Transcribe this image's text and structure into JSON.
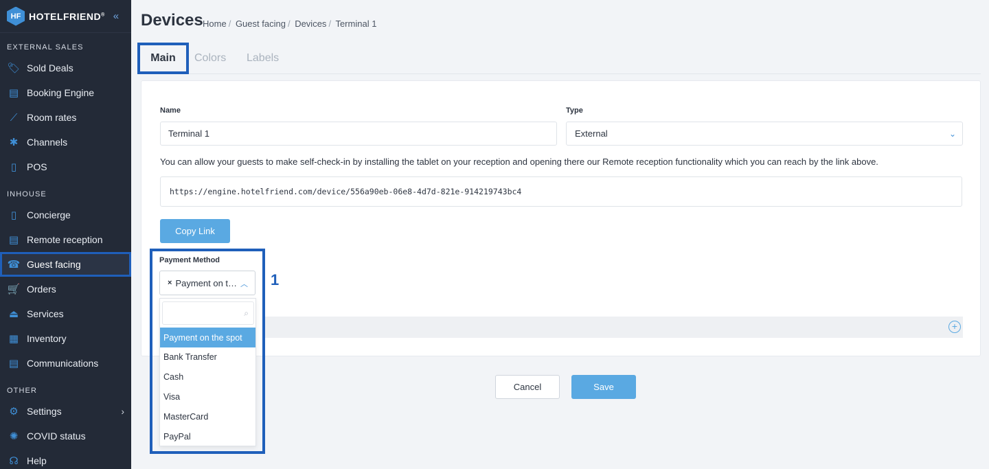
{
  "brand": {
    "logo_mark": "HF",
    "name": "HOTELFRIEND",
    "reg": "®"
  },
  "sidebar": {
    "sections": [
      {
        "title": "EXTERNAL SALES",
        "items": [
          {
            "label": "Sold Deals",
            "icon": "tag-icon",
            "glyph": "🏷"
          },
          {
            "label": "Booking Engine",
            "icon": "booking-engine-icon",
            "glyph": "▤"
          },
          {
            "label": "Room rates",
            "icon": "chart-line-icon",
            "glyph": "⟋"
          },
          {
            "label": "Channels",
            "icon": "channels-icon",
            "glyph": "✱"
          },
          {
            "label": "POS",
            "icon": "pos-icon",
            "glyph": "▯"
          }
        ]
      },
      {
        "title": "INHOUSE",
        "items": [
          {
            "label": "Concierge",
            "icon": "concierge-icon",
            "glyph": "▯"
          },
          {
            "label": "Remote reception",
            "icon": "remote-reception-icon",
            "glyph": "▤"
          },
          {
            "label": "Guest facing",
            "icon": "guest-facing-icon",
            "glyph": "☎",
            "active": true
          },
          {
            "label": "Orders",
            "icon": "cart-icon",
            "glyph": "🛒"
          },
          {
            "label": "Services",
            "icon": "cloche-icon",
            "glyph": "⏏"
          },
          {
            "label": "Inventory",
            "icon": "inventory-icon",
            "glyph": "▦"
          },
          {
            "label": "Communications",
            "icon": "chat-icon",
            "glyph": "▤"
          }
        ]
      },
      {
        "title": "OTHER",
        "items": [
          {
            "label": "Settings",
            "icon": "gear-icon",
            "glyph": "⚙",
            "chevron": "›"
          },
          {
            "label": "COVID status",
            "icon": "virus-icon",
            "glyph": "✺"
          },
          {
            "label": "Help",
            "icon": "headset-icon",
            "glyph": "☊"
          }
        ]
      }
    ]
  },
  "header": {
    "title": "Devices",
    "breadcrumb": [
      "Home",
      "Guest facing",
      "Devices",
      "Terminal 1"
    ]
  },
  "tabs": [
    "Main",
    "Colors",
    "Labels"
  ],
  "form": {
    "name_label": "Name",
    "name_value": "Terminal 1",
    "type_label": "Type",
    "type_value": "External",
    "helper_text": "You can allow your guests to make self-check-in by installing the tablet on your reception and opening there our Remote reception functionality which you can reach by the link above.",
    "link": "https://engine.hotelfriend.com/device/556a90eb-06e8-4d7d-821e-914219743bc4",
    "copy_button": "Copy Link",
    "payment_label": "Payment Method",
    "payment_selected": "Payment on the spot",
    "payment_options": [
      "Payment on the spot",
      "Bank Transfer",
      "Cash",
      "Visa",
      "MasterCard",
      "PayPal"
    ],
    "annotation": "1"
  },
  "actions": {
    "cancel": "Cancel",
    "save": "Save"
  },
  "colors": {
    "accent": "#5aa9e2",
    "highlight": "#1f5fba",
    "sidebar_bg": "#232a37"
  }
}
